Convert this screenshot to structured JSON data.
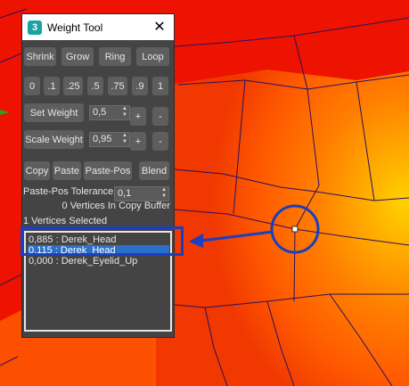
{
  "window": {
    "title": "Weight Tool",
    "app_icon_text": "3",
    "close_symbol": "✕"
  },
  "toolbar": {
    "shrink": "Shrink",
    "grow": "Grow",
    "ring": "Ring",
    "loop": "Loop"
  },
  "presets": [
    "0",
    ".1",
    ".25",
    ".5",
    ".75",
    ".9",
    "1"
  ],
  "set_weight": {
    "label": "Set Weight",
    "value": "0,5",
    "plus": "+",
    "minus": "-"
  },
  "scale_weight": {
    "label": "Scale Weight",
    "value": "0,95",
    "plus": "+",
    "minus": "-"
  },
  "clipboard": {
    "copy": "Copy",
    "paste": "Paste",
    "paste_pos": "Paste-Pos",
    "blend": "Blend"
  },
  "paste_pos_tolerance": {
    "label": "Paste-Pos Tolerance",
    "value": "0,1"
  },
  "status": {
    "copy_buffer": "0 Vertices In Copy Buffer",
    "selected": "1 Vertices Selected"
  },
  "bone_list": [
    {
      "text": "0,885 : Derek_Head",
      "selected": false
    },
    {
      "text": "0,115 : Derek_Head",
      "selected": true
    },
    {
      "text": "0,000 : Derek_Eyelid_Up",
      "selected": false
    }
  ],
  "colors": {
    "panel_bg": "#444444",
    "button_bg": "#5e5e5e",
    "selection": "#2d6ec8",
    "annotation_blue": "#1a3fbf",
    "viewport_red": "#ee1200",
    "viewport_orange": "#ff7a00",
    "viewport_yellow": "#ffcf00"
  }
}
